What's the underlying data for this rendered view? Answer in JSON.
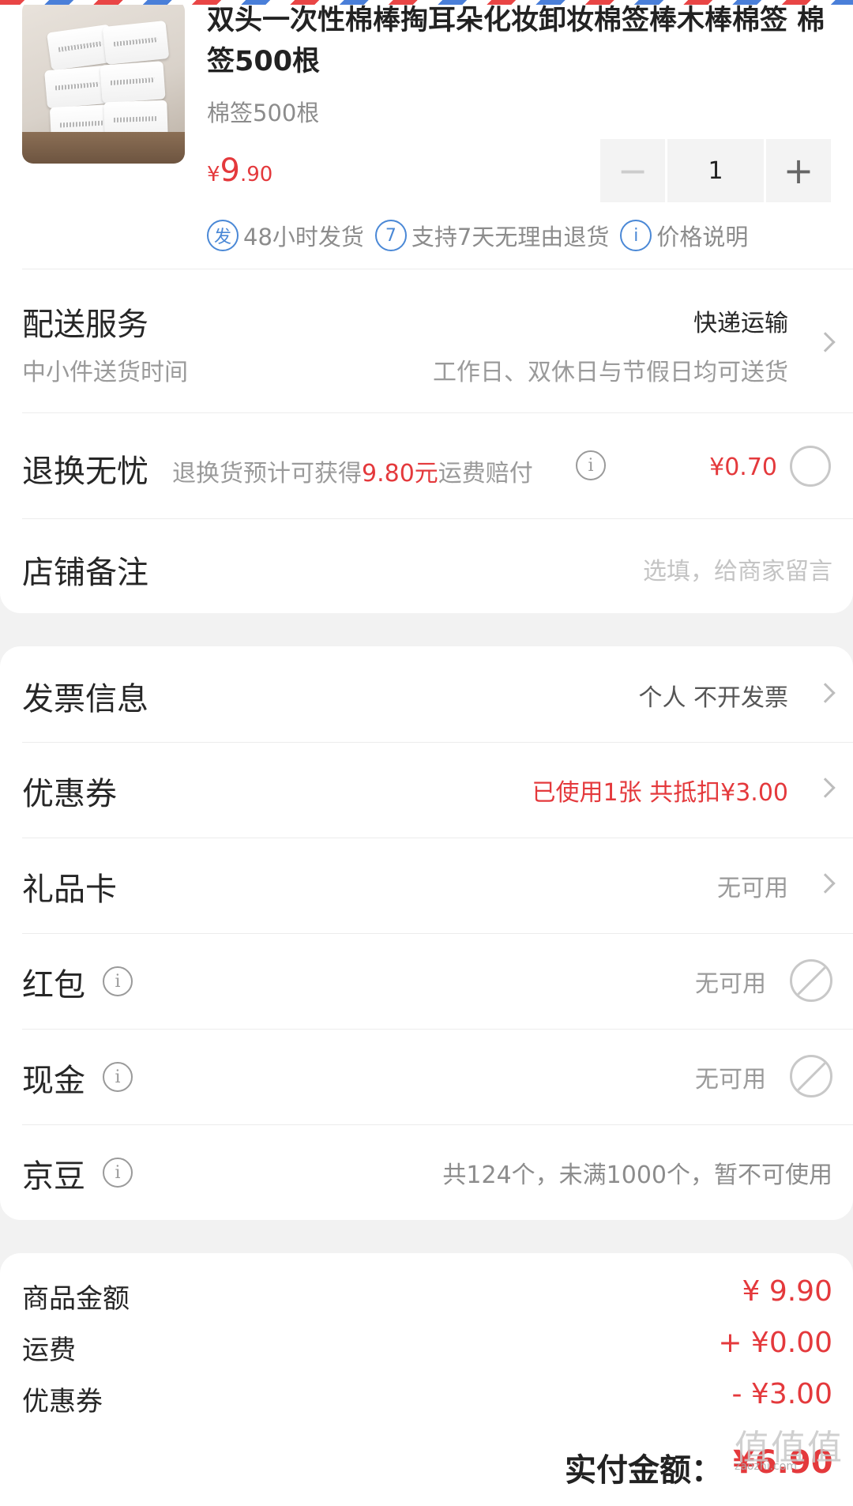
{
  "product": {
    "title": "双头一次性棉棒掏耳朵化妆卸妆棉签棒木棒棉签 棉签500根",
    "spec": "棉签500根",
    "price_symbol": "¥",
    "price_int": "9",
    "price_dec": ".90",
    "quantity": "1",
    "minus_label": "−",
    "plus_label": "+",
    "services": [
      {
        "icon": "发",
        "label": "48小时发货"
      },
      {
        "icon": "7",
        "label": "支持7天无理由退货"
      },
      {
        "icon": "i",
        "label": "价格说明"
      }
    ]
  },
  "delivery": {
    "title": "配送服务",
    "method": "快递运输",
    "sub_left": "中小件送货时间",
    "sub_right": "工作日、双休日与节假日均可送货"
  },
  "return_worry_free": {
    "title": "退换无忧",
    "desc_prefix": "退换货预计可获得",
    "desc_amount": "9.80元",
    "desc_suffix": "运费赔付",
    "price": "¥0.70"
  },
  "shop_note": {
    "title": "店铺备注",
    "placeholder": "选填，给商家留言"
  },
  "options": {
    "invoice": {
      "title": "发票信息",
      "value": "个人 不开发票"
    },
    "coupon": {
      "title": "优惠券",
      "value": "已使用1张 共抵扣¥3.00"
    },
    "gift_card": {
      "title": "礼品卡",
      "value": "无可用"
    },
    "red_packet": {
      "title": "红包",
      "value": "无可用"
    },
    "cash": {
      "title": "现金",
      "value": "无可用"
    },
    "jd_beans": {
      "title": "京豆",
      "value": "共124个，未满1000个，暂不可使用"
    }
  },
  "summary": {
    "items": [
      {
        "label": "商品金额",
        "value": "¥ 9.90"
      },
      {
        "label": "运费",
        "value": "+ ¥0.00"
      },
      {
        "label": "优惠券",
        "value": "- ¥3.00"
      }
    ],
    "total_label": "实付金额：",
    "total_value": "¥6.90"
  },
  "watermark": {
    "main": "值值值",
    "sub": "zaozhi.com"
  },
  "colors": {
    "accent": "#e4393c",
    "service_blue": "#4a88d6",
    "background": "#f2f2f2"
  }
}
